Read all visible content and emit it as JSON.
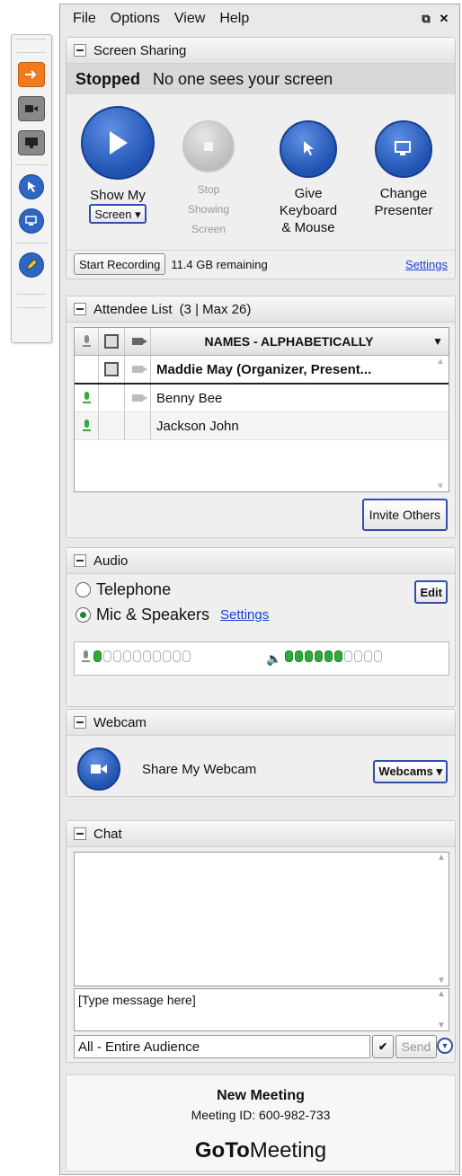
{
  "menu": [
    "File",
    "Options",
    "View",
    "Help"
  ],
  "screen_sharing": {
    "title": "Screen Sharing",
    "status_state": "Stopped",
    "status_text": "No one sees your screen",
    "show_my": "Show My",
    "screen_dropdown": "Screen ▾",
    "stop_line1": "Stop",
    "stop_line2": "Showing",
    "stop_line3": "Screen",
    "give_line1": "Give",
    "give_line2": "Keyboard",
    "give_line3": "& Mouse",
    "change_line1": "Change",
    "change_line2": "Presenter",
    "start_recording": "Start Recording",
    "remaining": "11.4 GB remaining",
    "settings": "Settings"
  },
  "attendees": {
    "title": "Attendee List",
    "count": "(3 | Max 26)",
    "sort_header": "NAMES - ALPHABETICALLY",
    "rows": [
      {
        "name": "Maddie May (Organizer, Present..."
      },
      {
        "name": "Benny Bee"
      },
      {
        "name": "Jackson John"
      }
    ],
    "invite": "Invite Others"
  },
  "audio": {
    "title": "Audio",
    "telephone": "Telephone",
    "mic_speakers": "Mic & Speakers",
    "settings": "Settings",
    "edit": "Edit",
    "mic_level": 1,
    "speaker_level": 6,
    "meter_total": 10
  },
  "webcam": {
    "title": "Webcam",
    "share": "Share My Webcam",
    "dropdown": "Webcams ▾"
  },
  "chat": {
    "title": "Chat",
    "placeholder": "[Type message here]",
    "audience": "All - Entire Audience",
    "send": "Send"
  },
  "footer": {
    "meeting_name": "New Meeting",
    "meeting_id": "Meeting ID: 600-982-733",
    "logo_bold": "GoTo",
    "logo_rest": "Meeting"
  }
}
